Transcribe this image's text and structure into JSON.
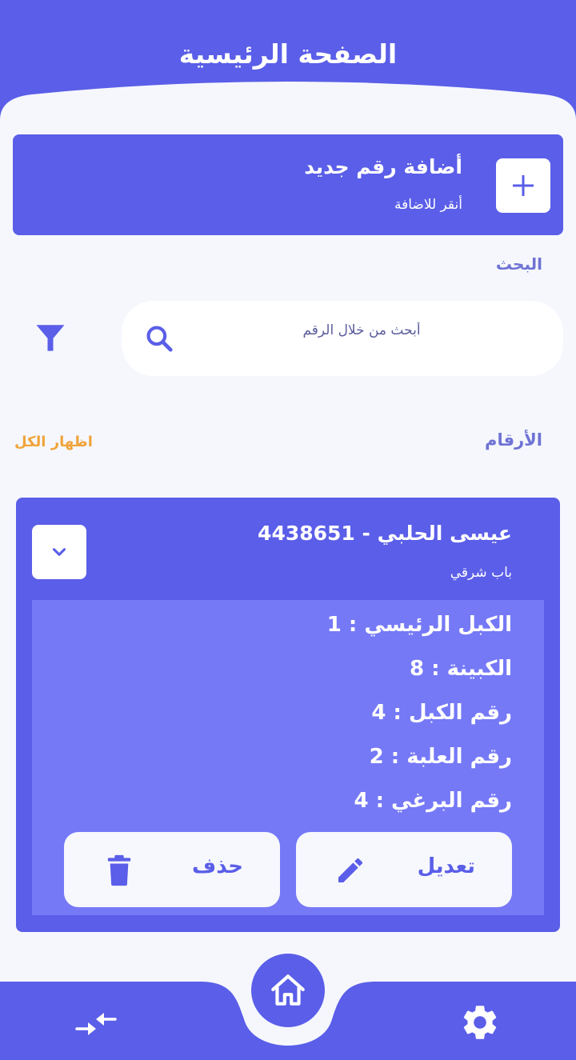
{
  "header": {
    "title": "الصفحة الرئيسية"
  },
  "add_card": {
    "title": "أضافة رقم جديد",
    "subtitle": "أنقر للاضافة",
    "icon": "plus-icon"
  },
  "search": {
    "label": "البحث",
    "placeholder": "أبحث من خلال الرقم",
    "icon": "search-icon",
    "filter_icon": "filter-icon"
  },
  "list": {
    "label": "الأرقام",
    "show_all": "اظهار الكل"
  },
  "entry": {
    "title": "عيسى الحلبي - 4438651",
    "subtitle": "باب شرقي",
    "details": [
      "الكبل الرئيسي : 1",
      "الكبينة : 8",
      "رقم الكبل : 4",
      "رقم العلبة : 2",
      "رقم البرغي : 4"
    ],
    "edit_label": "تعديل",
    "delete_label": "حذف"
  },
  "nav": {
    "items": [
      "swap-icon",
      "home-icon",
      "gear-icon"
    ]
  },
  "colors": {
    "primary": "#5a5ee8",
    "panel": "#7579f6",
    "accent": "#f0a43a",
    "background": "#f5f7fd"
  }
}
